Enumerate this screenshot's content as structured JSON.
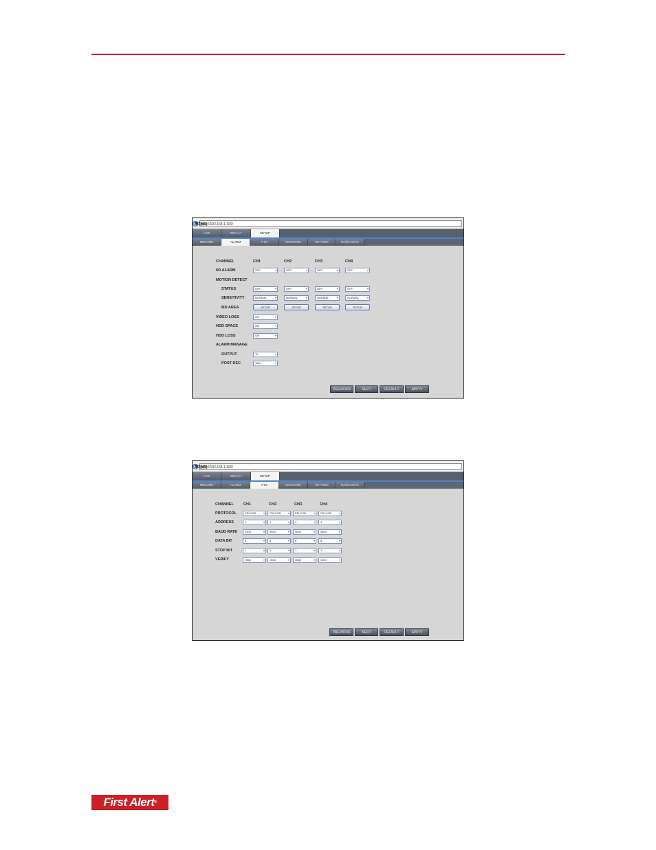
{
  "logo": {
    "text": "First Alert",
    "mark": "®"
  },
  "alarm_screen": {
    "address_label": "地址(D)",
    "url": "http://192.168.1.100/",
    "top_tabs": [
      "LIVE",
      "REPLAY",
      "SETUP"
    ],
    "sub_tabs": [
      "RECORD",
      "ALARM",
      "PTZ",
      "NETWORK",
      "SETTING",
      "BASIC INFO"
    ],
    "channel_label": "CHANNEL",
    "channels": [
      "CH1",
      "CH2",
      "CH3",
      "CH4"
    ],
    "io_alarm": {
      "label": "I/O ALARM",
      "values": [
        "OFF",
        "OFF",
        "OFF",
        "OFF"
      ]
    },
    "motion_detect_label": "MOTION DETECT",
    "status": {
      "label": "STATUS",
      "values": [
        "OFF",
        "OFF",
        "OFF",
        "OFF"
      ]
    },
    "sensitivity": {
      "label": "SENSITIVITY",
      "values": [
        "NORMAL",
        "NORMAL",
        "NORMAL",
        "NORMAL"
      ]
    },
    "md_area": {
      "label": "MD AREA",
      "button": "SETUP"
    },
    "video_loss": {
      "label": "VIDEO LOSS",
      "value": "ON"
    },
    "hdd_space": {
      "label": "HDD SPACE",
      "value": "ON"
    },
    "hdd_loss": {
      "label": "HDD LOSS",
      "value": "ON"
    },
    "alarm_manage_label": "ALARM MANAGE",
    "output": {
      "label": "OUTPUT",
      "value": "10"
    },
    "post_rec": {
      "label": "POST REC",
      "value": "1Min"
    },
    "buttons": [
      "PREVIOUS",
      "NEXT",
      "DEFAULT",
      "APPLY"
    ]
  },
  "ptz_screen": {
    "address_label": "地址(D)",
    "url": "http://192.168.1.100/",
    "top_tabs": [
      "LIVE",
      "REPLAY",
      "SETUP"
    ],
    "sub_tabs": [
      "RECORD",
      "ALARM",
      "PTZ",
      "NETWORK",
      "SETTING",
      "BASIC INFO"
    ],
    "channel_label": "CHANNEL",
    "channels": [
      "CH1",
      "CH2",
      "CH3",
      "CH4"
    ],
    "rows": [
      {
        "label": "PROTOCOL",
        "values": [
          "PELCOD",
          "PELCOD",
          "PELCOD",
          "PELCOD"
        ]
      },
      {
        "label": "ADDRESS",
        "values": [
          "1",
          "1",
          "1",
          "1"
        ]
      },
      {
        "label": "BAUD RATE",
        "values": [
          "2400",
          "9600",
          "9600",
          "9600"
        ]
      },
      {
        "label": "DATA BIT",
        "values": [
          "8",
          "8",
          "8",
          "8"
        ]
      },
      {
        "label": "STOP BIT",
        "values": [
          "1",
          "1",
          "1",
          "1"
        ]
      },
      {
        "label": "VERIFY",
        "values": [
          "ODD",
          "ODD",
          "ODD",
          "ODD"
        ]
      }
    ],
    "buttons": [
      "PREVIOUS",
      "NEXT",
      "DEFAULT",
      "APPLY"
    ]
  }
}
